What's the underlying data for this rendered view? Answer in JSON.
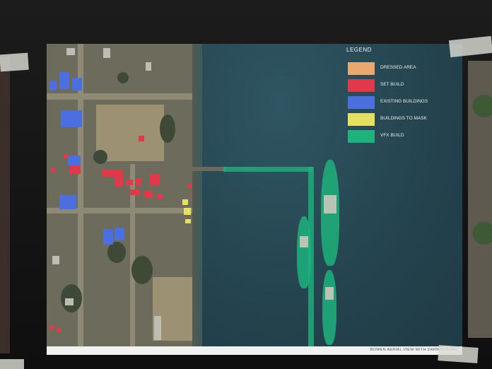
{
  "legend": {
    "title": "LEGEND",
    "items": [
      {
        "label": "DRESSED AREA",
        "color": "#e8a870"
      },
      {
        "label": "SET BUILD",
        "color": "#e0394a"
      },
      {
        "label": "EXISTING BUILDINGS",
        "color": "#4c6fe0"
      },
      {
        "label": "BUILDINGS TO MASK",
        "color": "#e6e062"
      },
      {
        "label": "VFX BUILD",
        "color": "#1fb27c"
      }
    ]
  },
  "caption": "BOWEN AERIAL VIEW WITH DARWIN PLAN",
  "colors": {
    "water": "#24434e",
    "land": "#6d6b5c",
    "set_build": "#e0394a",
    "existing": "#4c6fe0",
    "mask": "#e6e062",
    "vfx": "#1fb27c"
  }
}
